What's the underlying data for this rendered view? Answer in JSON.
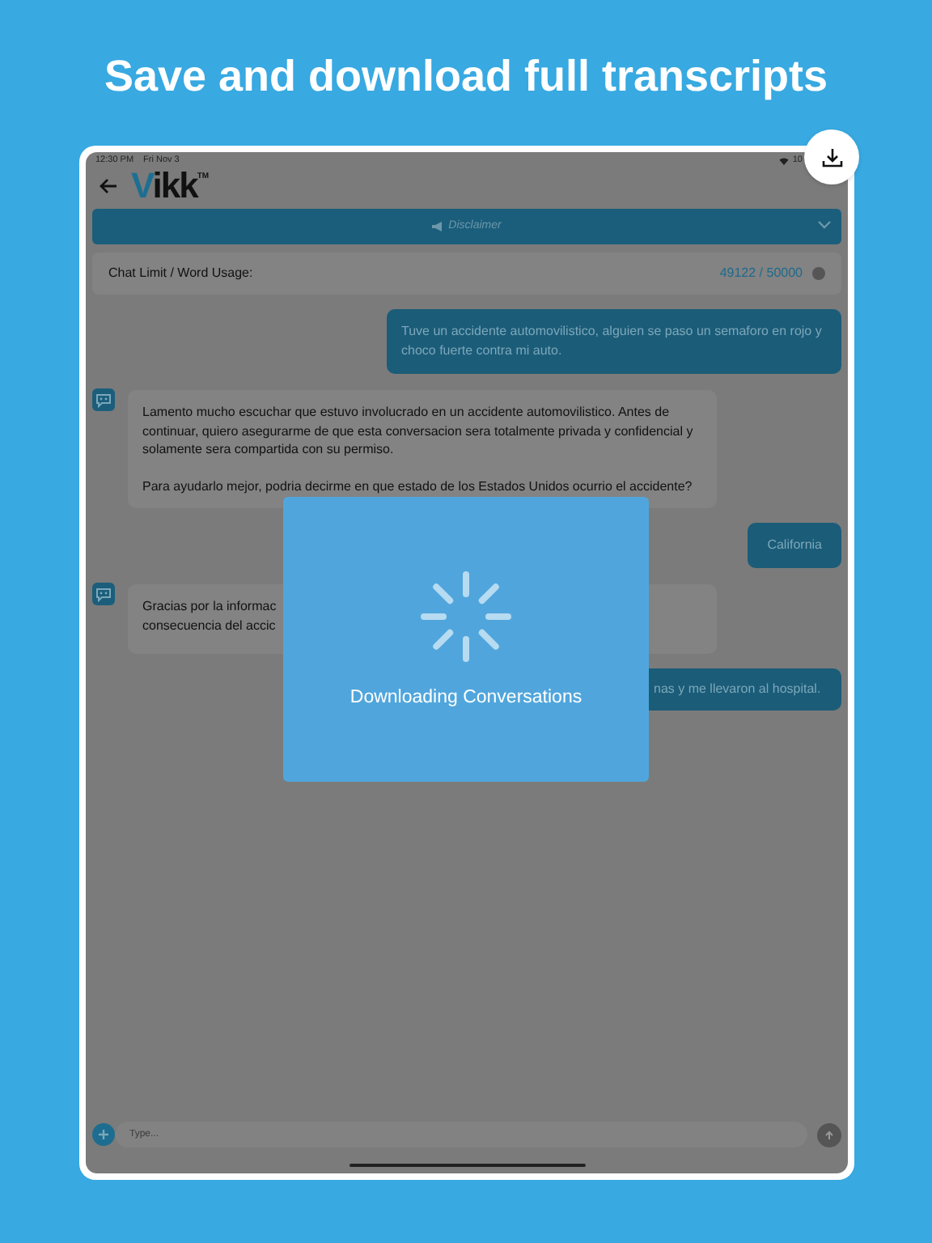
{
  "headline": "Save and download full transcripts",
  "status_bar": {
    "time": "12:30 PM",
    "date": "Fri Nov 3",
    "battery": "10"
  },
  "header": {
    "logo": "Vikk",
    "trademark": "TM"
  },
  "disclaimer": {
    "label": "Disclaimer",
    "expanded": false
  },
  "usage": {
    "label": "Chat Limit / Word Usage:",
    "value": "49122 / 50000"
  },
  "messages": [
    {
      "kind": "user",
      "text": "Tuve un accidente automovilistico, alguien se paso un semaforo en rojo y choco fuerte contra mi auto."
    },
    {
      "kind": "bot",
      "paragraphs": [
        "Lamento mucho escuchar que estuvo involucrado en un accidente automovilistico. Antes de continuar, quiero asegurarme de que esta conversacion sera totalmente privada y confidencial y solamente sera compartida con su permiso.",
        "Para ayudarlo mejor, podria decirme en que estado de los Estados Unidos ocurrio el accidente?"
      ]
    },
    {
      "kind": "user",
      "text": "California"
    },
    {
      "kind": "bot",
      "lines": [
        "Gracias por la informac",
        "consecuencia del accic"
      ]
    },
    {
      "kind": "user_cut",
      "text": "nas y me llevaron al hospital."
    }
  ],
  "composer": {
    "placeholder": "Type..."
  },
  "modal": {
    "text": "Downloading Conversations"
  }
}
